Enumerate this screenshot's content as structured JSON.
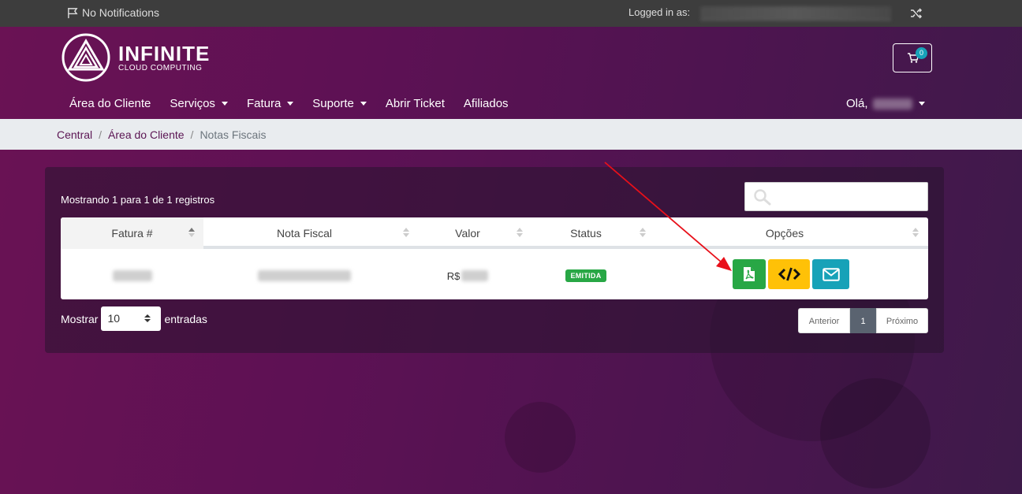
{
  "topbar": {
    "notifications": "No Notifications",
    "logged_in_label": "Logged in as:"
  },
  "logo": {
    "brand": "INFINITE",
    "tagline": "CLOUD COMPUTING"
  },
  "cart": {
    "count": "0"
  },
  "nav": {
    "items": [
      {
        "label": "Área do Cliente",
        "dropdown": false
      },
      {
        "label": "Serviços",
        "dropdown": true
      },
      {
        "label": "Fatura",
        "dropdown": true
      },
      {
        "label": "Suporte",
        "dropdown": true
      },
      {
        "label": "Abrir Ticket",
        "dropdown": false
      },
      {
        "label": "Afiliados",
        "dropdown": false
      }
    ],
    "greeting": "Olá,"
  },
  "breadcrumb": {
    "home": "Central",
    "client_area": "Área do Cliente",
    "current": "Notas Fiscais"
  },
  "table": {
    "info": "Mostrando 1 para 1 de 1 registros",
    "columns": [
      "Fatura #",
      "Nota Fiscal",
      "Valor",
      "Status",
      "Opções"
    ],
    "rows": [
      {
        "valor_prefix": "R$",
        "status": "EMITIDA"
      }
    ]
  },
  "length": {
    "show_label": "Mostrar",
    "value": "10",
    "entries_label": "entradas"
  },
  "pagination": {
    "prev": "Anterior",
    "current": "1",
    "next": "Próximo"
  },
  "colors": {
    "pdf_button": "#28a745",
    "xml_button": "#ffc107",
    "email_button": "#17a2b8",
    "status_emitida": "#28a745",
    "annotation_arrow": "#e8101a"
  }
}
